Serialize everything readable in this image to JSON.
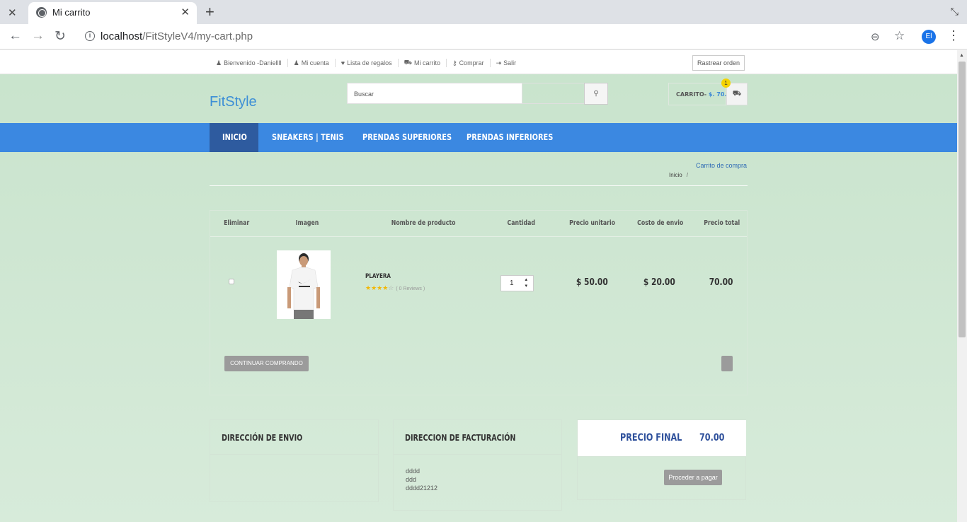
{
  "browser": {
    "tab_title": "Mi carrito",
    "url_host": "localhost",
    "url_path": "/FitStyleV4/my-cart.php",
    "profile_initials": "El"
  },
  "top_links": [
    {
      "icon": "user-icon",
      "label": "Bienvenido -Daniellll"
    },
    {
      "icon": "user-icon",
      "label": "Mi cuenta"
    },
    {
      "icon": "heart-icon",
      "label": "Lista de regalos"
    },
    {
      "icon": "cart-icon",
      "label": "Mi carrito"
    },
    {
      "icon": "key-icon",
      "label": "Comprar"
    },
    {
      "icon": "logout-icon",
      "label": "Salir"
    }
  ],
  "track_order_label": "Rastrear orden",
  "header": {
    "logo": "FitStyle",
    "search_placeholder": "Buscar",
    "cart_label": "CARRITO-",
    "cart_total": "$. 70.00",
    "cart_count": "1"
  },
  "nav": [
    "INICIO",
    "SNEAKERS | TENIS",
    "PRENDAS SUPERIORES",
    "PRENDAS INFERIORES"
  ],
  "breadcrumb": {
    "title": "Carrito de compra",
    "home": "Inicio",
    "sep": "/"
  },
  "cart_table": {
    "headers": [
      "Eliminar",
      "Imagen",
      "Nombre de producto",
      "Cantidad",
      "Precio unitario",
      "Costo de envio",
      "Precio total"
    ],
    "row": {
      "product_name": "PLAYERA",
      "rating": 4,
      "reviews": "( 0 Reviews )",
      "quantity": "1",
      "unit_price": "$ 50.00",
      "shipping": "$ 20.00",
      "total": "70.00"
    },
    "continue_label": "CONTINUAR COMPRANDO"
  },
  "shipping_panel": {
    "title": "DIRECCIÓN DE ENVIO"
  },
  "billing_panel": {
    "title": "DIRECCION DE FACTURACIÓN",
    "lines": [
      "dddd",
      "ddd",
      "dddd21212"
    ]
  },
  "final_panel": {
    "label": "PRECIO FINAL",
    "value": "70.00",
    "pay_label": "Proceder a pagar"
  },
  "colors": {
    "nav_bg": "#3b88e1",
    "nav_active": "#2e5b9f",
    "page_bg": "#c8e3cc",
    "accent_blue": "#2d4f9b",
    "logo": "#3d8fd6",
    "badge": "#f5d300"
  }
}
